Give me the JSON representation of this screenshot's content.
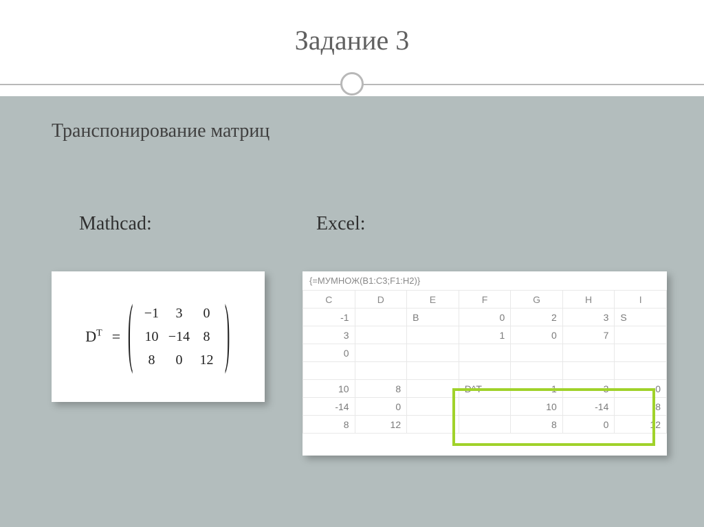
{
  "title": "Задание 3",
  "subtitle": "Транспонирование матриц",
  "labels": {
    "mathcad": "Mathcad:",
    "excel": "Excel:"
  },
  "mathcad": {
    "symbol": "D",
    "superscript": "T",
    "equals": "=",
    "matrix": [
      [
        "−1",
        "3",
        "0"
      ],
      [
        "10",
        "−14",
        "8"
      ],
      [
        "8",
        "0",
        "12"
      ]
    ]
  },
  "excel": {
    "formula": "{=МУМНОЖ(B1:C3;F1:H2)}",
    "columns": [
      "C",
      "D",
      "E",
      "F",
      "G",
      "H",
      "I"
    ],
    "rows": [
      [
        "-1",
        "",
        "B",
        "0",
        "2",
        "3",
        "S"
      ],
      [
        "3",
        "",
        "",
        "1",
        "0",
        "7",
        ""
      ],
      [
        "0",
        "",
        "",
        "",
        "",
        "",
        ""
      ],
      [
        "",
        "",
        "",
        "",
        "",
        "",
        ""
      ],
      [
        "10",
        "8",
        "",
        "D^T",
        "-1",
        "3",
        "0"
      ],
      [
        "-14",
        "0",
        "",
        "",
        "10",
        "-14",
        "8"
      ],
      [
        "8",
        "12",
        "",
        "",
        "8",
        "0",
        "12"
      ]
    ],
    "dt_label": "D^T"
  }
}
